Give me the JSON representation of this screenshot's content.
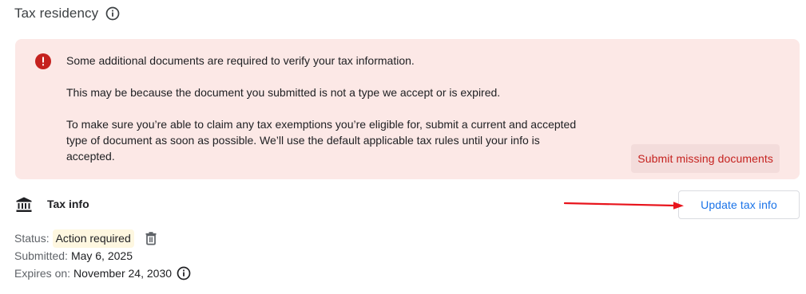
{
  "section": {
    "title": "Tax residency",
    "info_icon": "info-icon"
  },
  "alert": {
    "icon": "error-icon",
    "line1": "Some additional documents are required to verify your tax information.",
    "line2": "This may be because the document you submitted is not a type we accept or is expired.",
    "line3": "To make sure you’re able to claim any tax exemptions you’re eligible for, submit a current and accepted type of document as soon as possible. We’ll use the default applicable tax rules until your info is accepted.",
    "action_label": "Submit missing documents",
    "background_color": "#fce8e6",
    "accent_color": "#c5221f"
  },
  "tax_info": {
    "icon": "bank-icon",
    "label": "Tax info",
    "update_button_label": "Update tax info",
    "button_text_color": "#1a73e8"
  },
  "annotation": {
    "type": "red-arrow",
    "color": "#e8141c"
  },
  "details": {
    "status_key": "Status:",
    "status_value": "Action required",
    "status_badge_color": "#fef7e0",
    "submitted_key": "Submitted:",
    "submitted_value": "May 6, 2025",
    "expires_key": "Expires on:",
    "expires_value": "November 24, 2030",
    "delete_icon": "trash-icon",
    "expires_info_icon": "info-icon"
  }
}
